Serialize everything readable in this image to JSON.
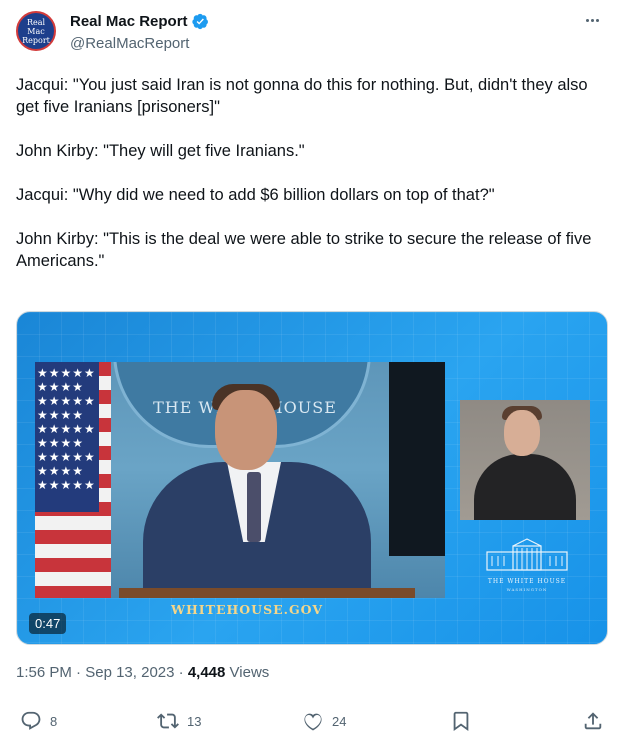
{
  "author": {
    "avatar_lines": [
      "Real",
      "Mac",
      "Report"
    ],
    "display_name": "Real Mac Report",
    "handle": "@RealMacReport",
    "verified_color": "#1d9bf0"
  },
  "tweet": {
    "paragraphs": [
      "Jacqui: \"You just said Iran is not gonna do this for nothing. But, didn't they also get five Iranians [prisoners]\"",
      "John Kirby: \"They will get five Iranians.\"",
      "Jacqui: \"Why did we need to add $6 billion dollars on top of that?\"",
      "John Kirby: \"This is the deal we were able to strike to secure the release of five Americans.\""
    ]
  },
  "media": {
    "seal_text": "THE WHITE HOUSE",
    "seal_subtext": "WASHINGTON",
    "flag_stars": "★★★★★ ★★★★ ★★★★★ ★★★★ ★★★★★ ★★★★ ★★★★★ ★★★★ ★★★★★",
    "website": "WHITEHOUSE.GOV",
    "logo_caption": "THE WHITE HOUSE",
    "logo_subcaption": "WASHINGTON",
    "duration": "0:47"
  },
  "meta": {
    "time": "1:56 PM",
    "date": "Sep 13, 2023",
    "views_count": "4,448",
    "views_label": "Views"
  },
  "actions": {
    "replies": "8",
    "retweets": "13",
    "likes": "24"
  },
  "colors": {
    "text_primary": "#0f1419",
    "text_secondary": "#536471",
    "media_blue": "#1a86d6"
  }
}
